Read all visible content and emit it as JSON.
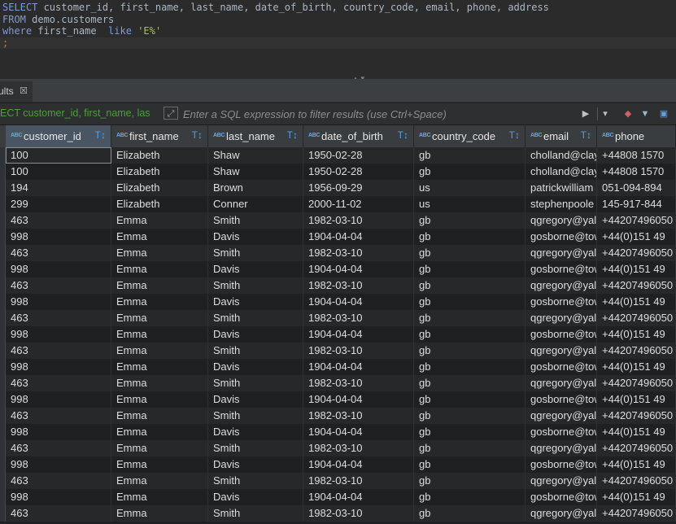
{
  "editor": {
    "lines": [
      {
        "parts": [
          {
            "t": "SELECT",
            "c": "kw"
          },
          {
            "t": " customer_id, first_name, last_name, date_of_birth, country_code, email, phone, address",
            "c": ""
          }
        ]
      },
      {
        "parts": [
          {
            "t": "FROM",
            "c": "kw"
          },
          {
            "t": " demo.customers",
            "c": ""
          }
        ]
      },
      {
        "parts": [
          {
            "t": "where",
            "c": "kw"
          },
          {
            "t": " first_name  ",
            "c": ""
          },
          {
            "t": "like",
            "c": "kw"
          },
          {
            "t": " ",
            "c": ""
          },
          {
            "t": "'E%'",
            "c": "str"
          }
        ]
      },
      {
        "parts": [
          {
            "t": ";",
            "c": "semi"
          }
        ]
      }
    ]
  },
  "tab": {
    "label": "ults",
    "close_icon": "close-icon"
  },
  "filter": {
    "query_text": "ECT customer_id, first_name, las",
    "placeholder": "Enter a SQL expression to filter results (use Ctrl+Space)",
    "value": ""
  },
  "columns": [
    {
      "type": "ABC",
      "name": "customer_id"
    },
    {
      "type": "ABC",
      "name": "first_name"
    },
    {
      "type": "ABC",
      "name": "last_name"
    },
    {
      "type": "ABC",
      "name": "date_of_birth"
    },
    {
      "type": "ABC",
      "name": "country_code"
    },
    {
      "type": "ABC",
      "name": "email"
    },
    {
      "type": "ABC",
      "name": "phone"
    }
  ],
  "rows": [
    [
      "100",
      "Elizabeth",
      "Shaw",
      "1950-02-28",
      "gb",
      "cholland@clay",
      "+44808 1570"
    ],
    [
      "100",
      "Elizabeth",
      "Shaw",
      "1950-02-28",
      "gb",
      "cholland@clay",
      "+44808 1570"
    ],
    [
      "194",
      "Elizabeth",
      "Brown",
      "1956-09-29",
      "us",
      "patrickwilliam",
      "051-094-894"
    ],
    [
      "299",
      "Elizabeth",
      "Conner",
      "2000-11-02",
      "us",
      "stephenpoole",
      "145-917-844"
    ],
    [
      "463",
      "Emma",
      "Smith",
      "1982-03-10",
      "gb",
      "qgregory@yal",
      "+44207496050"
    ],
    [
      "998",
      "Emma",
      "Davis",
      "1904-04-04",
      "gb",
      "gosborne@tow",
      "+44(0)151 49"
    ],
    [
      "463",
      "Emma",
      "Smith",
      "1982-03-10",
      "gb",
      "qgregory@yal",
      "+44207496050"
    ],
    [
      "998",
      "Emma",
      "Davis",
      "1904-04-04",
      "gb",
      "gosborne@tow",
      "+44(0)151 49"
    ],
    [
      "463",
      "Emma",
      "Smith",
      "1982-03-10",
      "gb",
      "qgregory@yal",
      "+44207496050"
    ],
    [
      "998",
      "Emma",
      "Davis",
      "1904-04-04",
      "gb",
      "gosborne@tow",
      "+44(0)151 49"
    ],
    [
      "463",
      "Emma",
      "Smith",
      "1982-03-10",
      "gb",
      "qgregory@yal",
      "+44207496050"
    ],
    [
      "998",
      "Emma",
      "Davis",
      "1904-04-04",
      "gb",
      "gosborne@tow",
      "+44(0)151 49"
    ],
    [
      "463",
      "Emma",
      "Smith",
      "1982-03-10",
      "gb",
      "qgregory@yal",
      "+44207496050"
    ],
    [
      "998",
      "Emma",
      "Davis",
      "1904-04-04",
      "gb",
      "gosborne@tow",
      "+44(0)151 49"
    ],
    [
      "463",
      "Emma",
      "Smith",
      "1982-03-10",
      "gb",
      "qgregory@yal",
      "+44207496050"
    ],
    [
      "998",
      "Emma",
      "Davis",
      "1904-04-04",
      "gb",
      "gosborne@tow",
      "+44(0)151 49"
    ],
    [
      "463",
      "Emma",
      "Smith",
      "1982-03-10",
      "gb",
      "qgregory@yal",
      "+44207496050"
    ],
    [
      "998",
      "Emma",
      "Davis",
      "1904-04-04",
      "gb",
      "gosborne@tow",
      "+44(0)151 49"
    ],
    [
      "463",
      "Emma",
      "Smith",
      "1982-03-10",
      "gb",
      "qgregory@yal",
      "+44207496050"
    ],
    [
      "998",
      "Emma",
      "Davis",
      "1904-04-04",
      "gb",
      "gosborne@tow",
      "+44(0)151 49"
    ],
    [
      "463",
      "Emma",
      "Smith",
      "1982-03-10",
      "gb",
      "qgregory@yal",
      "+44207496050"
    ],
    [
      "998",
      "Emma",
      "Davis",
      "1904-04-04",
      "gb",
      "gosborne@tow",
      "+44(0)151 49"
    ],
    [
      "463",
      "Emma",
      "Smith",
      "1982-03-10",
      "gb",
      "qgregory@yal",
      "+44207496050"
    ]
  ],
  "colors": {
    "keyword": "#7e9bd6",
    "string": "#a5c261",
    "accent": "#4e9fe6"
  }
}
